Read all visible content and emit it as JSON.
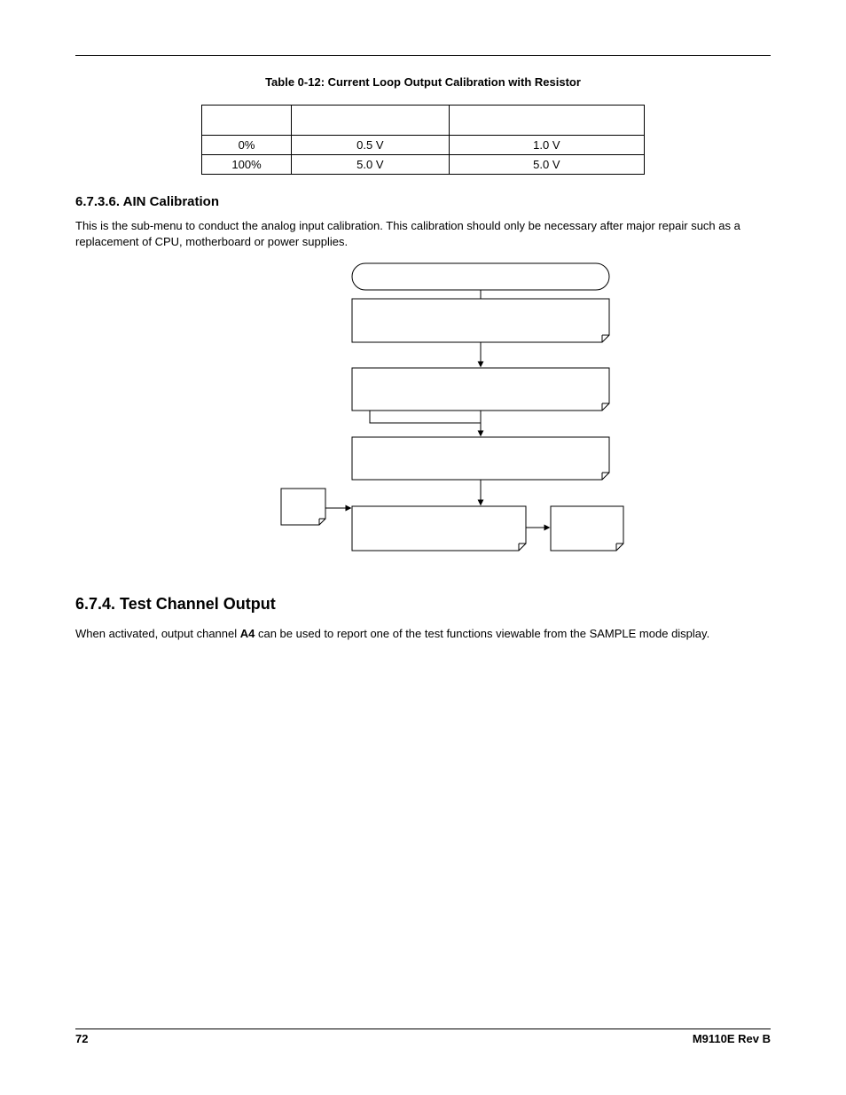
{
  "table": {
    "caption": "Table 0-12:  Current Loop Output Calibration with Resistor",
    "rows": [
      {
        "c0": "0%",
        "c1": "0.5 V",
        "c2": "1.0 V"
      },
      {
        "c0": "100%",
        "c1": "5.0 V",
        "c2": "5.0 V"
      }
    ]
  },
  "section_ain": {
    "heading": "6.7.3.6. AIN Calibration",
    "para": "This is the sub-menu to conduct the analog input calibration. This calibration should only be necessary after major repair such as a replacement of CPU, motherboard or power supplies."
  },
  "section_test": {
    "heading": "6.7.4. Test Channel Output",
    "para_pre": "When activated, output channel ",
    "para_bold": "A4",
    "para_post": " can be used to report one of the test functions viewable from the SAMPLE mode display."
  },
  "footer": {
    "page": "72",
    "rev": "M9110E Rev B"
  }
}
